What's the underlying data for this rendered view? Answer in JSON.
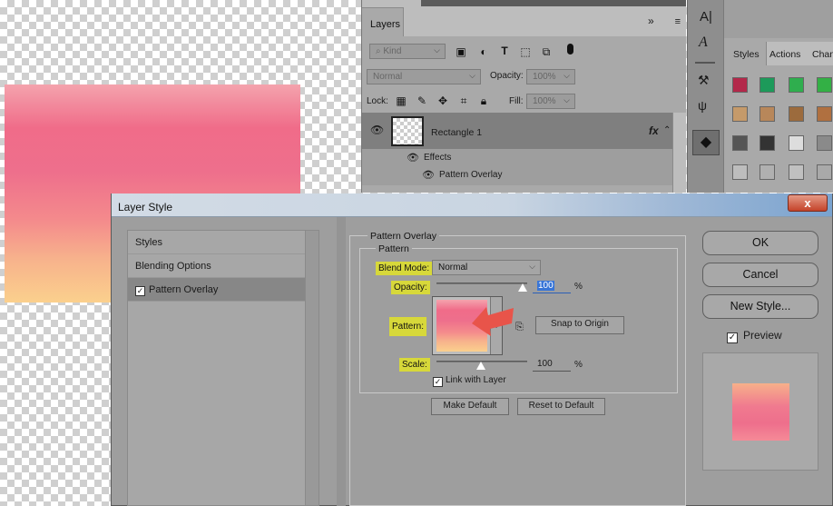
{
  "layers_panel": {
    "tab_label": "Layers",
    "collapse_icon": "double-chevron-right",
    "filter": {
      "kind_label": "Kind"
    },
    "blend_mode": "Normal",
    "opacity_label": "Opacity:",
    "opacity_value": "100%",
    "lock_label": "Lock:",
    "fill_label": "Fill:",
    "fill_value": "100%",
    "layer_name": "Rectangle 1",
    "fx_label": "fx",
    "effects_label": "Effects",
    "effect_item": "Pattern Overlay"
  },
  "right_panel": {
    "tab_styles": "Styles",
    "tab_actions": "Actions",
    "tab_channels": "Chann"
  },
  "dialog": {
    "title": "Layer Style",
    "close_label": "x",
    "left_items": [
      "Styles",
      "Blending Options",
      "Pattern Overlay"
    ],
    "section_title": "Pattern Overlay",
    "group_title": "Pattern",
    "blend_mode_label": "Blend Mode:",
    "blend_mode_value": "Normal",
    "opacity_label": "Opacity:",
    "opacity_value": "100",
    "opacity_unit": "%",
    "opacity_level": 1.0,
    "pattern_label": "Pattern:",
    "snap_button": "Snap to Origin",
    "scale_label": "Scale:",
    "scale_value": "100",
    "scale_unit": "%",
    "link_label": "Link with Layer",
    "make_default": "Make Default",
    "reset_default": "Reset to Default",
    "ok": "OK",
    "cancel": "Cancel",
    "new_style": "New Style...",
    "preview_label": "Preview"
  },
  "colors": {
    "highlight": "#d7d83a",
    "arrow": "#e8544a",
    "title_gradient_end": "#7aa3cf"
  }
}
